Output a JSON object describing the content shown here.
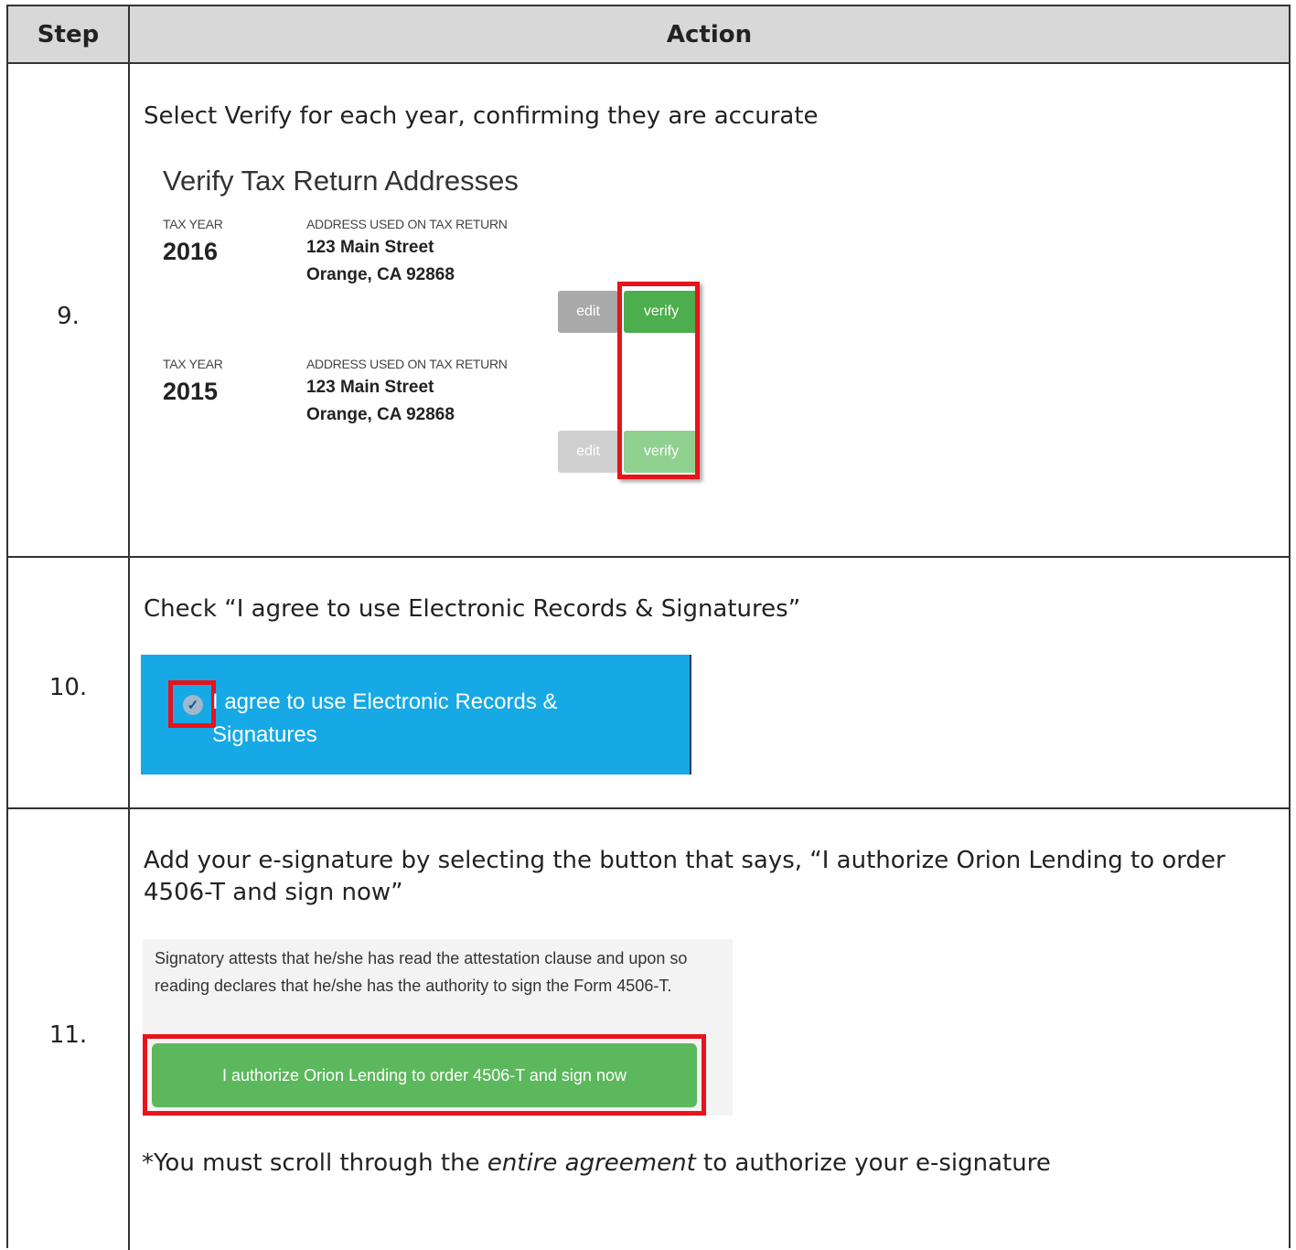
{
  "header": {
    "step": "Step",
    "action": "Action"
  },
  "rows": [
    {
      "step": "9.",
      "instruction": "Select Verify for each year, confirming they are accurate",
      "screenshot": {
        "title": "Verify Tax Return Addresses",
        "entries": [
          {
            "tax_year_label": "TAX YEAR",
            "year": "2016",
            "address_label": "ADDRESS USED ON TAX RETURN",
            "street": "123 Main Street",
            "city": "Orange, CA 92868",
            "edit": "edit",
            "verify": "verify"
          },
          {
            "tax_year_label": "TAX YEAR",
            "year": "2015",
            "address_label": "ADDRESS USED ON TAX RETURN",
            "street": "123 Main Street",
            "city": "Orange, CA 92868",
            "edit": "edit",
            "verify": "verify"
          }
        ]
      }
    },
    {
      "step": "10.",
      "instruction": "Check “I agree to use Electronic Records & Signatures”",
      "screenshot": {
        "checkbox_label": "I agree to use Electronic Records & Signatures",
        "checkmark": "✓"
      }
    },
    {
      "step": "11.",
      "instruction": "Add your e-signature by selecting the button that says, “I authorize Orion Lending to order 4506-T and sign now”",
      "screenshot": {
        "attestation": "Signatory attests that he/she has read the attestation clause and upon so reading declares that he/she has the authority to sign the Form 4506-T.",
        "button": "I authorize Orion Lending to order 4506-T and sign now"
      },
      "note_prefix": "*You must scroll through the ",
      "note_emphasis": "entire agreement",
      "note_suffix": " to authorize your e-signature"
    }
  ],
  "colors": {
    "highlight": "#e8131b",
    "verify_green": "#4cae4c",
    "blue_banner": "#16a9e5",
    "header_gray": "#d8d8d8"
  }
}
